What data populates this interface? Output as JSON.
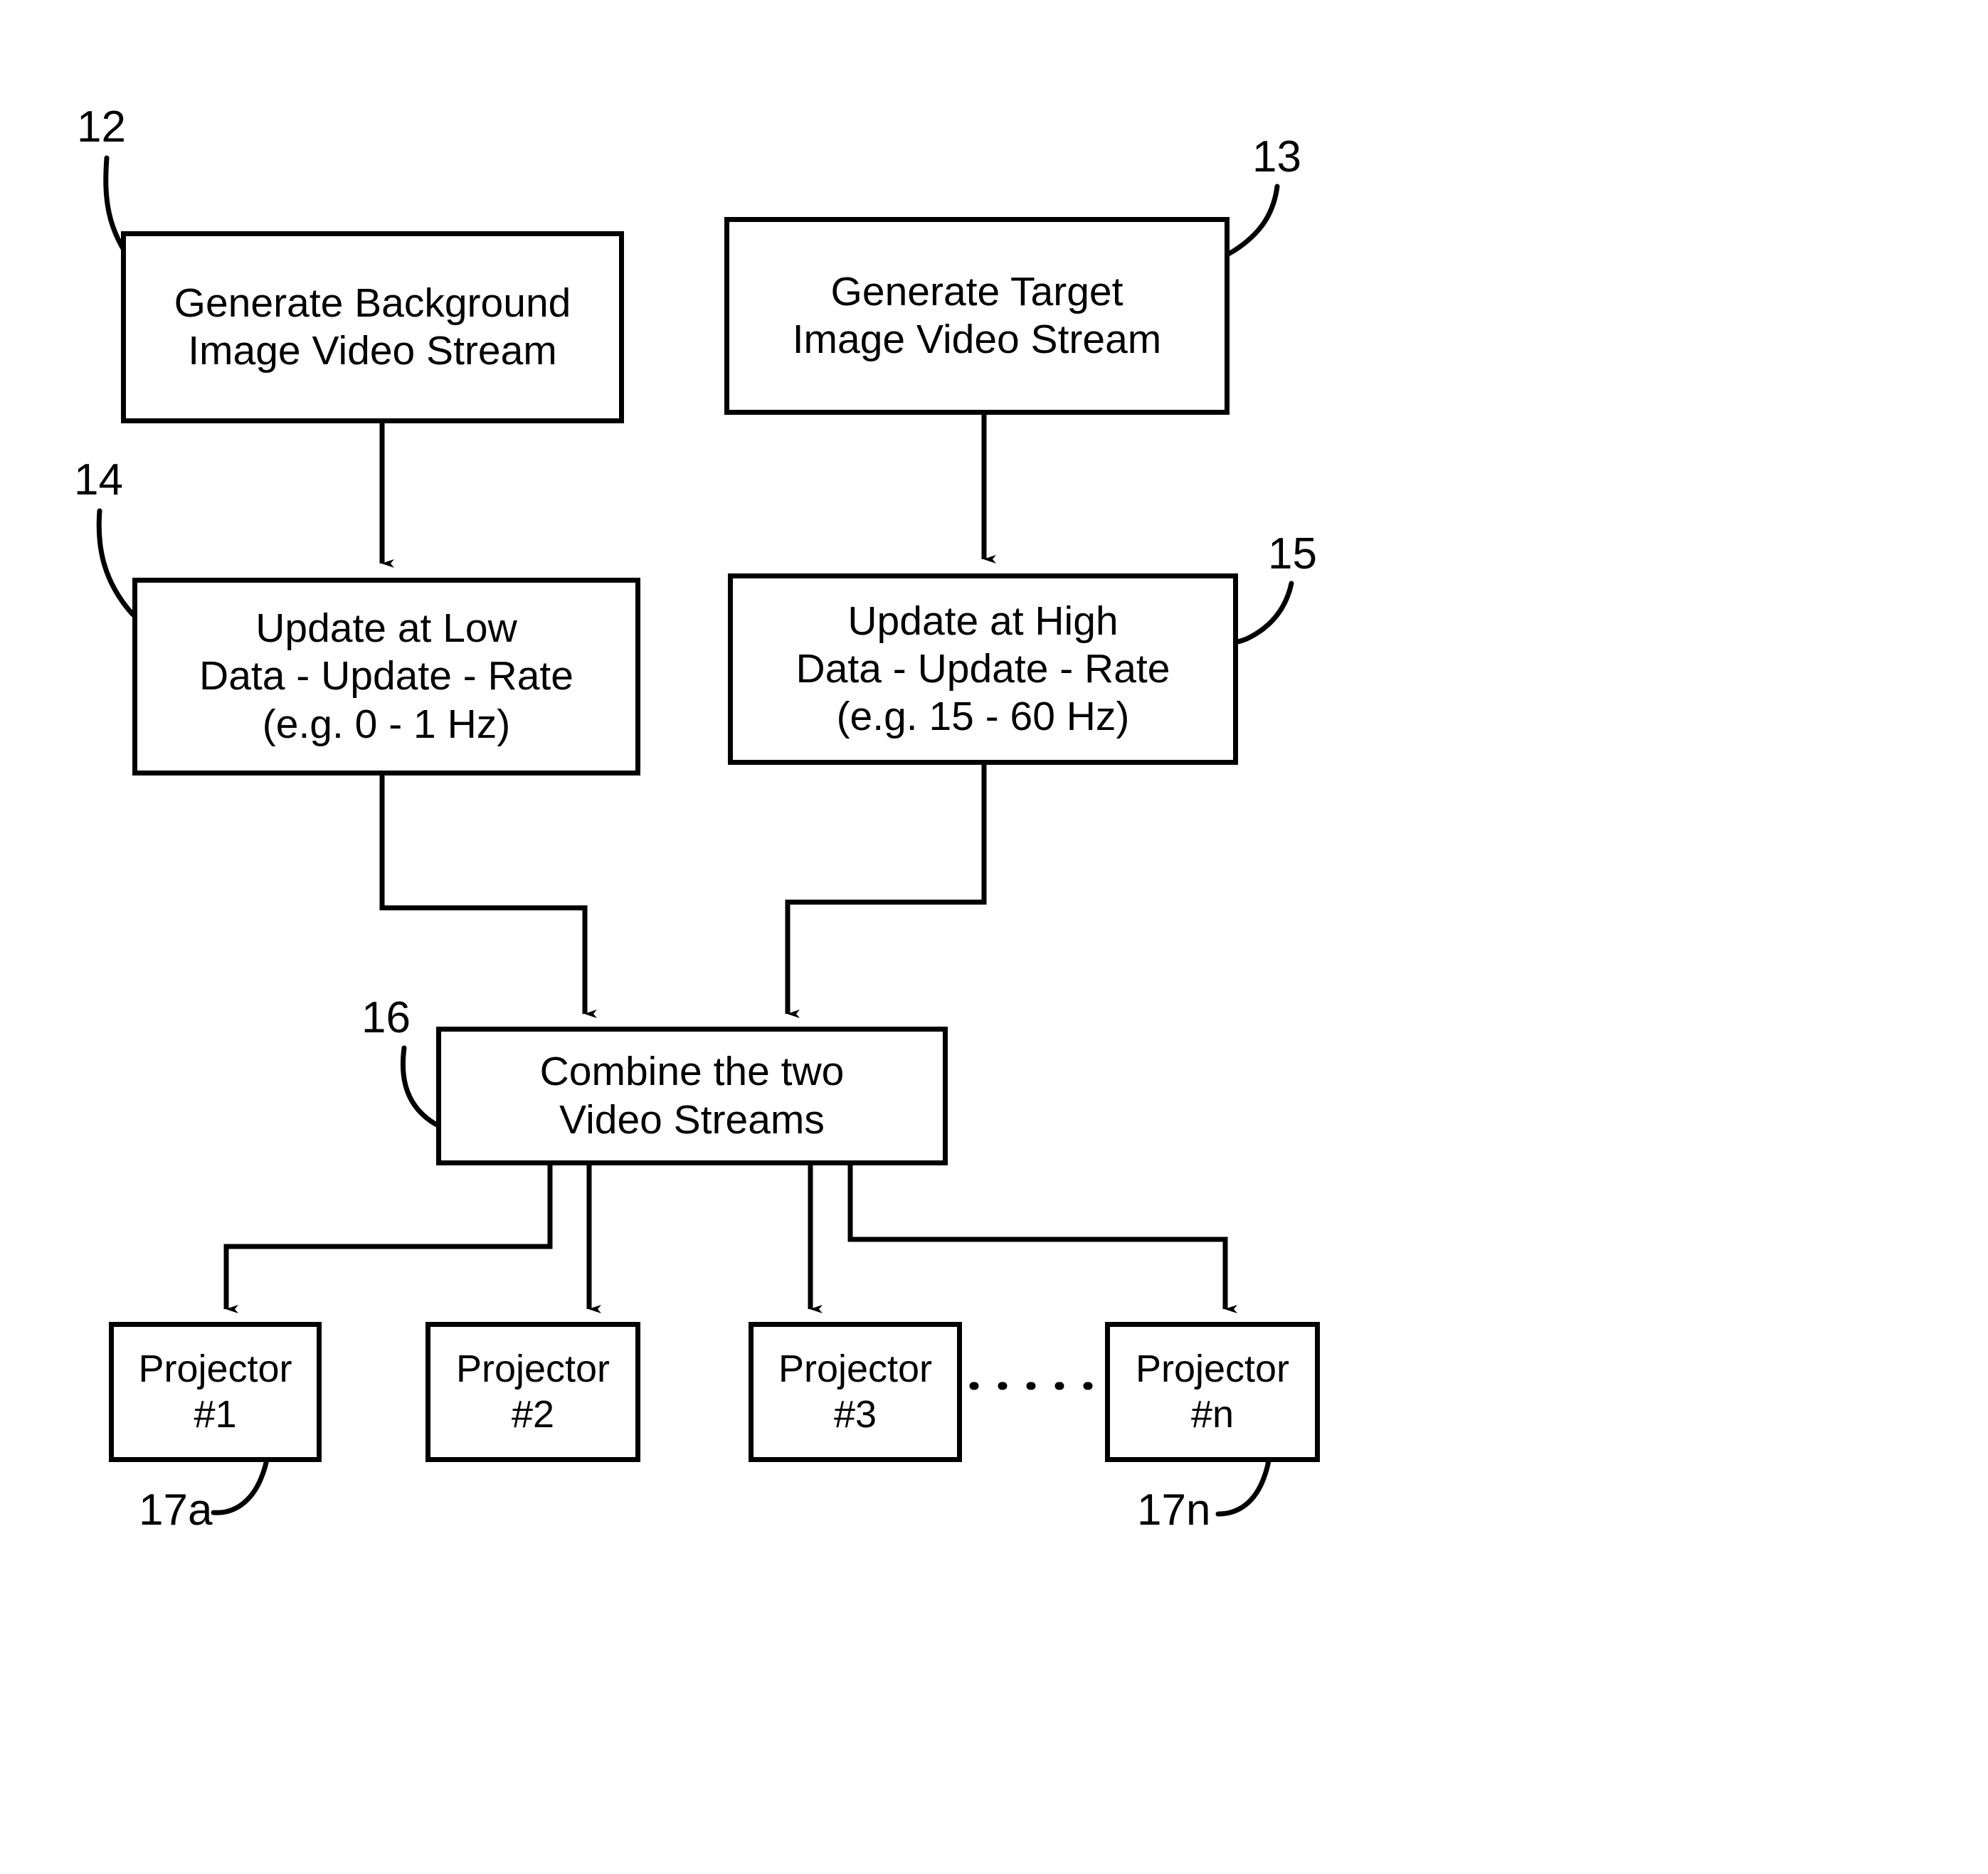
{
  "figure": {
    "type": "patent-flow-diagram",
    "background_color": "#ffffff",
    "line_color": "#000000"
  },
  "nodes": {
    "generate_background": {
      "ref": "12",
      "line1": "Generate Background",
      "line2": "Image Video Stream"
    },
    "generate_target": {
      "ref": "13",
      "line1": "Generate Target",
      "line2": "Image Video Stream"
    },
    "update_low": {
      "ref": "14",
      "line1": "Update at Low",
      "line2": "Data - Update - Rate",
      "line3": "(e.g. 0 - 1 Hz)"
    },
    "update_high": {
      "ref": "15",
      "line1": "Update at High",
      "line2": "Data - Update - Rate",
      "line3": "(e.g. 15 - 60 Hz)"
    },
    "combine": {
      "ref": "16",
      "line1": "Combine the two",
      "line2": "Video Streams"
    }
  },
  "projectors": [
    {
      "line1": "Projector",
      "line2": "#1",
      "ref": "17a"
    },
    {
      "line1": "Projector",
      "line2": "#2",
      "ref": ""
    },
    {
      "line1": "Projector",
      "line2": "#3",
      "ref": ""
    },
    {
      "line1": "Projector",
      "line2": "#n",
      "ref": "17n"
    }
  ],
  "ellipsis": {
    "style": "dotted-line",
    "between": [
      "Projector #3",
      "Projector #n"
    ]
  }
}
